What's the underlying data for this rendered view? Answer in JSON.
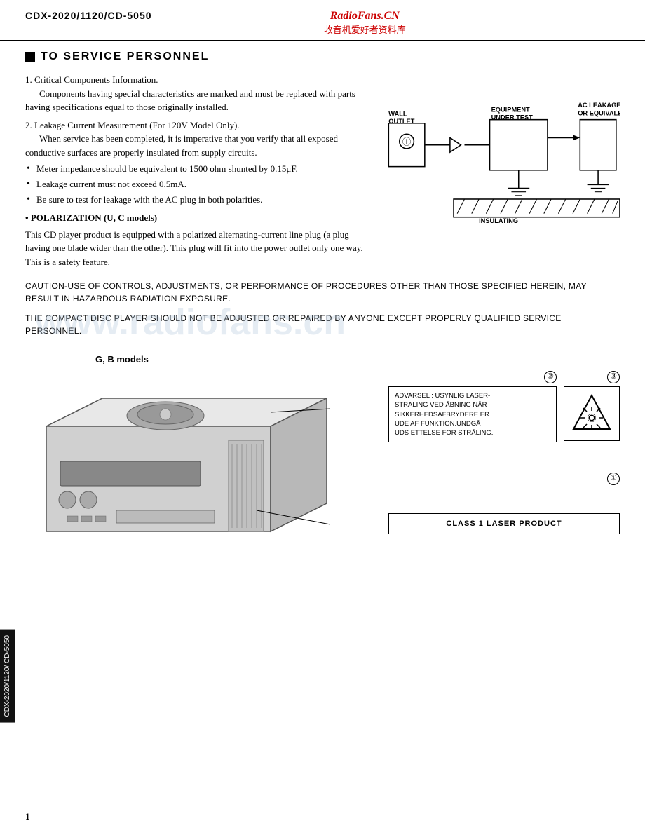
{
  "header": {
    "model": "CDX-2020/1120/CD-5050",
    "site_name": "RadioFans.CN",
    "site_chinese": "收音机爱好者资料库"
  },
  "section_title": "TO SERVICE PERSONNEL",
  "items": [
    {
      "num": "1.",
      "title": "Critical Components Information.",
      "body": "Components having special characteristics are marked and must be replaced with parts having specifications equal to those originally installed."
    },
    {
      "num": "2.",
      "title": "Leakage Current Measurement (For 120V Model Only).",
      "body": "When service has been completed, it is imperative that you verify that all exposed conductive surfaces are properly insulated from supply circuits."
    }
  ],
  "bullets": [
    "Meter impedance should be equivalent to 1500 ohm shunted by 0.15μF.",
    "Leakage current must not exceed 0.5mA.",
    "Be sure to test for leakage with the AC plug in both polarities."
  ],
  "polarization_title": "POLARIZATION (U, C models)",
  "polarization_body": "This CD player product is equipped with a polarized alternating-current line plug (a plug having one blade wider than the other). This plug will fit into the power outlet only one way. This is a safety feature.",
  "diagram": {
    "wall_outlet": "WALL\nOUTLET",
    "equipment": "EQUIPMENT\nUNDER TEST",
    "ac_tester": "AC LEAKAGE TESTER\nOR EQUIVALENT",
    "insulating_table": "INSULATING\nTABLE"
  },
  "cautions": [
    "CAUTION-USE OF CONTROLS, ADJUSTMENTS, OR PERFORMANCE OF PROCEDURES OTHER THAN THOSE SPECIFIED HEREIN, MAY RESULT IN HAZARDOUS RADIATION EXPOSURE.",
    "THE COMPACT DISC PLAYER SHOULD NOT BE ADJUSTED OR REPAIRED BY ANYONE EXCEPT PROPERLY QUALIFIED SERVICE PERSONNEL."
  ],
  "models_label": "G, B models",
  "callout2_num": "②",
  "callout3_num": "③",
  "callout1_num": "①",
  "laser_warning_text": "ADVARSEL : USYNLIG LASER-\nSTRALING VED ÅBNING NÅR\nSIKKERHEDSAFBRYDERE ER\nUDE AF FUNKTION.UNDGÅ\nUDS ETTELSE FOR STRÅLING.",
  "class1_label": "CLASS 1 LASER PRODUCT",
  "watermark": "www.radiofans.cn",
  "side_label": "CDX-2020/1120/\nCD-5050",
  "page_number": "1"
}
